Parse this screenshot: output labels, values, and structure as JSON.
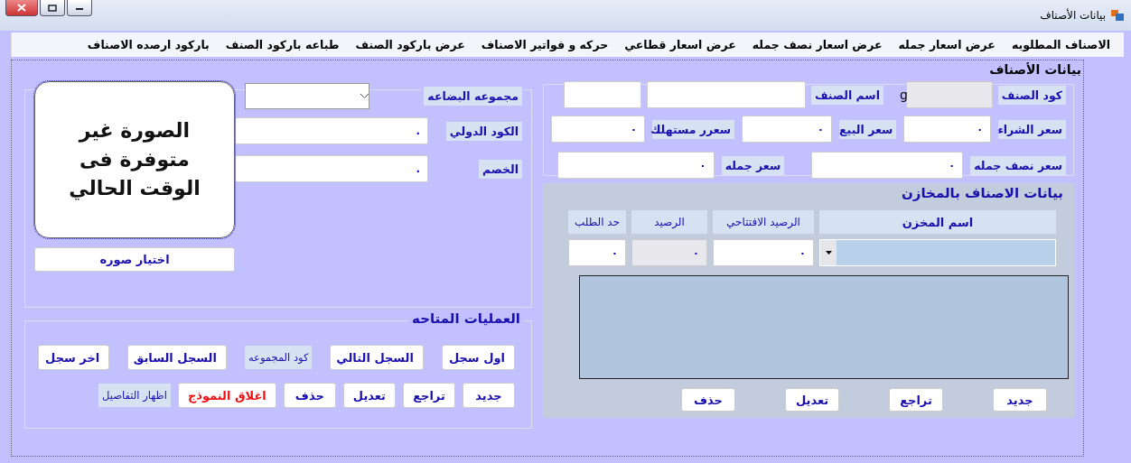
{
  "window": {
    "title": "بيانات الأصناف"
  },
  "menu": [
    "الاصناف المطلوبه",
    "عرض اسعار جمله",
    "عرض اسعار نصف جمله",
    "عرض اسعار قطاعي",
    "حركه و فواتير الاصناف",
    "عرض باركود الصنف",
    "طباعه باركود الصنف",
    "باركود ارصده الاصناف"
  ],
  "form_heading": "بيانات الأصناف",
  "item_group": {
    "code_label": "كود الصنف",
    "code_suffix": "g",
    "name_label": "اسم الصنف",
    "price_rows": [
      [
        {
          "label": "سعر الشراء",
          "value": "٠"
        },
        {
          "label": "سعر البيع",
          "value": "٠"
        },
        {
          "label": "سعرر مستهلك",
          "value": "٠"
        }
      ],
      [
        {
          "label": "سعر نصف جمله",
          "value": "٠"
        },
        {
          "label": "سعر جمله",
          "value": "٠"
        }
      ]
    ]
  },
  "stores": {
    "title": "بيانات الاصناف بالمخازن",
    "columns": [
      "اسم المخزن",
      "الرصيد الافتتاحي",
      "الرصيد",
      "حد الطلب"
    ],
    "inputs": [
      {
        "kind": "combo"
      },
      {
        "kind": "text",
        "value": "٠",
        "disabled": false
      },
      {
        "kind": "text",
        "value": "٠",
        "disabled": true
      },
      {
        "kind": "text",
        "value": "٠",
        "disabled": false
      }
    ],
    "buttons": [
      "جديد",
      "تراجع",
      "تعديل",
      "حذف"
    ]
  },
  "goods_group": {
    "label": "مجموعه البضاعه",
    "fields": [
      {
        "label": "الكود الدولي",
        "value": "."
      },
      {
        "label": "الخصم",
        "value": "."
      }
    ],
    "image_text": "الصورة غير متوفرة فى الوقت الحالي",
    "image_button": "اختيار صوره"
  },
  "operations": {
    "title": "العمليات المتاحه",
    "navigation": [
      {
        "kind": "button",
        "text": "اول سجل"
      },
      {
        "kind": "button",
        "text": "السجل التالي"
      },
      {
        "kind": "label",
        "text": "كود المجموعه"
      },
      {
        "kind": "button",
        "text": "السجل السابق"
      },
      {
        "kind": "button",
        "text": "اخر سجل"
      }
    ],
    "editing": [
      {
        "kind": "button",
        "text": "جديد"
      },
      {
        "kind": "button",
        "text": "تراجع"
      },
      {
        "kind": "button",
        "text": "تعديل"
      },
      {
        "kind": "button",
        "text": "حذف"
      },
      {
        "kind": "danger",
        "text": "اغلاق النموذج"
      },
      {
        "kind": "label",
        "text": "اظهار التفاصيل"
      }
    ]
  }
}
